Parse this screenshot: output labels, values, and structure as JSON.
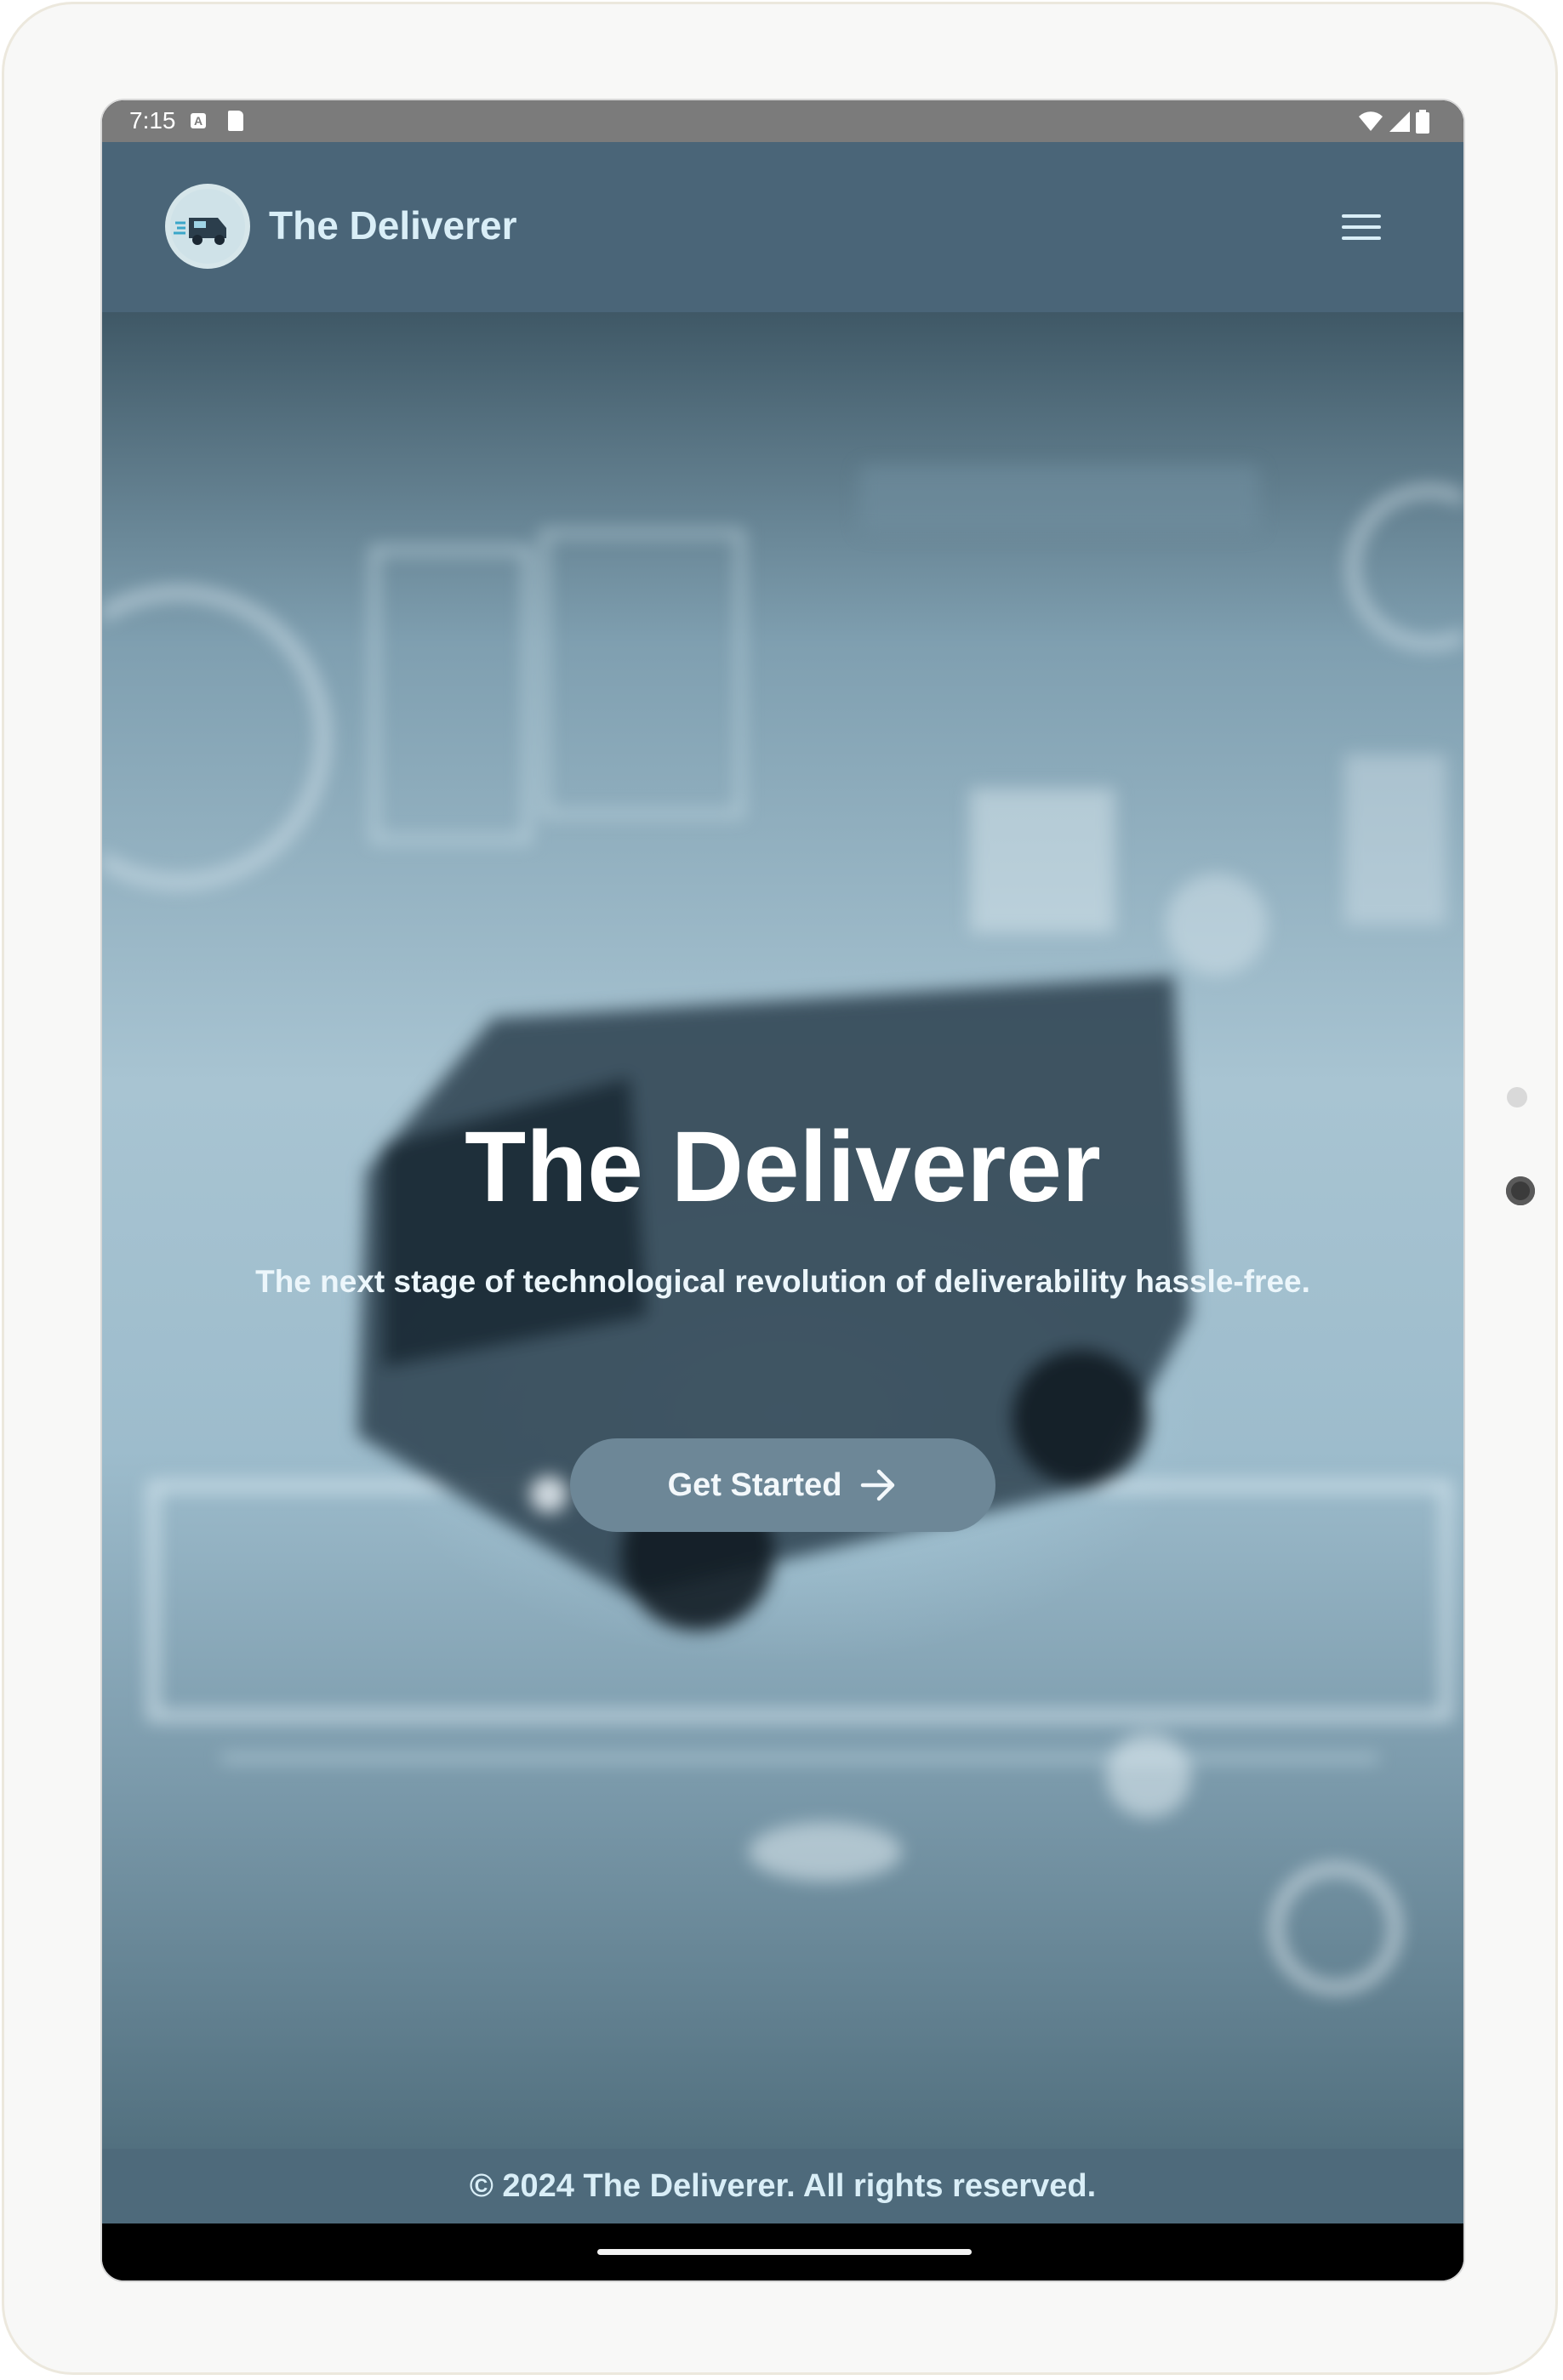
{
  "status_bar": {
    "time": "7:15",
    "notification_badge": "A",
    "icons": [
      "sd-card-icon",
      "wifi-icon",
      "signal-icon",
      "battery-icon"
    ]
  },
  "header": {
    "brand_name": "The Deliverer",
    "logo_icon": "delivery-van-logo-icon",
    "menu_icon": "hamburger-menu-icon"
  },
  "hero": {
    "title": "The Deliverer",
    "subtitle": "The next stage of technological revolution of deliverability hassle-free.",
    "cta_label": "Get Started",
    "cta_icon": "arrow-right-icon"
  },
  "footer": {
    "copyright": "© 2024 The Deliverer. All rights reserved."
  },
  "colors": {
    "header_bg": "#4a6578",
    "brand_text": "#d9eef7",
    "cta_bg": "#6d8797",
    "footer_bg": "#4e6a7b"
  }
}
